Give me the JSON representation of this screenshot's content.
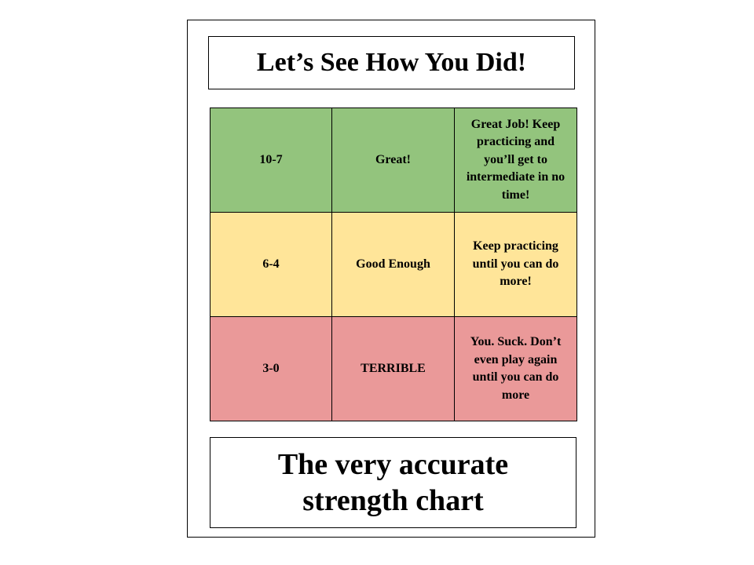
{
  "title": "Let’s See How You Did!",
  "rows": [
    {
      "score": "10-7",
      "rating": "Great!",
      "message": "Great Job! Keep practicing and you’ll get to intermediate in no time!",
      "color": "#93c47d"
    },
    {
      "score": "6-4",
      "rating": "Good Enough",
      "message": "Keep practicing until you can do more!",
      "color": "#ffe599"
    },
    {
      "score": "3-0",
      "rating": "TERRIBLE",
      "message": "You. Suck. Don’t even play again until you can do more",
      "color": "#ea9999"
    }
  ],
  "caption": {
    "line1": "The very accurate",
    "line2": "strength chart"
  }
}
